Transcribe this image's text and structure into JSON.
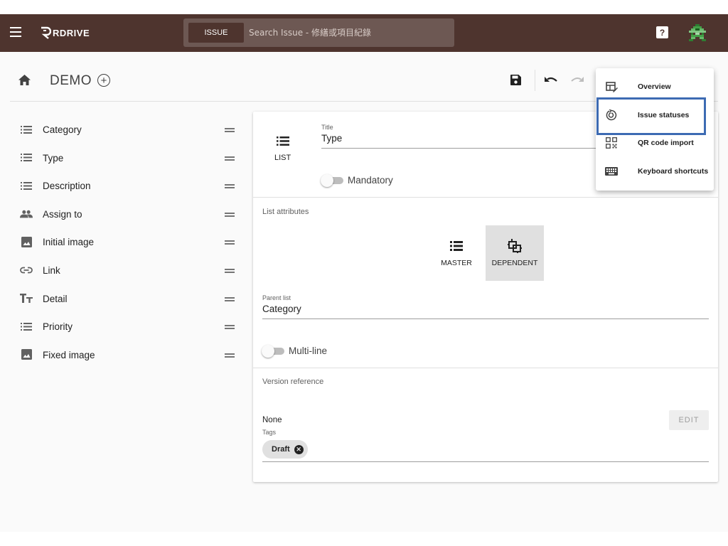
{
  "header": {
    "brand": "RDRIVE",
    "search_button": "ISSUE",
    "search_placeholder": "Search Issue - 修繕或項目紀錄",
    "help_glyph": "?"
  },
  "titlebar": {
    "title": "DEMO",
    "add_glyph": "+"
  },
  "sidebar": {
    "items": [
      {
        "label": "Category",
        "icon": "list-icon"
      },
      {
        "label": "Type",
        "icon": "list-icon"
      },
      {
        "label": "Description",
        "icon": "list-icon"
      },
      {
        "label": "Assign to",
        "icon": "people-icon"
      },
      {
        "label": "Initial image",
        "icon": "image-icon"
      },
      {
        "label": "Link",
        "icon": "link-icon"
      },
      {
        "label": "Detail",
        "icon": "text-fields-icon"
      },
      {
        "label": "Priority",
        "icon": "list-icon"
      },
      {
        "label": "Fixed image",
        "icon": "image-icon"
      }
    ]
  },
  "field_editor": {
    "type_label": "LIST",
    "title_label": "Title",
    "title_value": "Type",
    "mandatory_label": "Mandatory",
    "list_attributes_label": "List attributes",
    "master_label": "MASTER",
    "dependent_label": "DEPENDENT",
    "selected_attribute": "DEPENDENT",
    "parent_list_label": "Parent list",
    "parent_list_value": "Category",
    "multiline_label": "Multi-line",
    "version_reference_label": "Version reference",
    "version_reference_value": "None",
    "edit_button": "EDIT",
    "tags_label": "Tags",
    "tags": [
      "Draft"
    ]
  },
  "dropdown_menu": {
    "items": [
      {
        "label": "Overview",
        "icon": "overview-icon"
      },
      {
        "label": "Issue statuses",
        "icon": "issue-status-icon"
      },
      {
        "label": "QR code import",
        "icon": "qr-code-icon"
      },
      {
        "label": "Keyboard shortcuts",
        "icon": "keyboard-icon"
      }
    ],
    "highlighted": "Issue statuses"
  },
  "colors": {
    "appbar": "#4e342e",
    "highlight_border": "#3d6bb3",
    "selected_segment": "#e0e0e0"
  }
}
